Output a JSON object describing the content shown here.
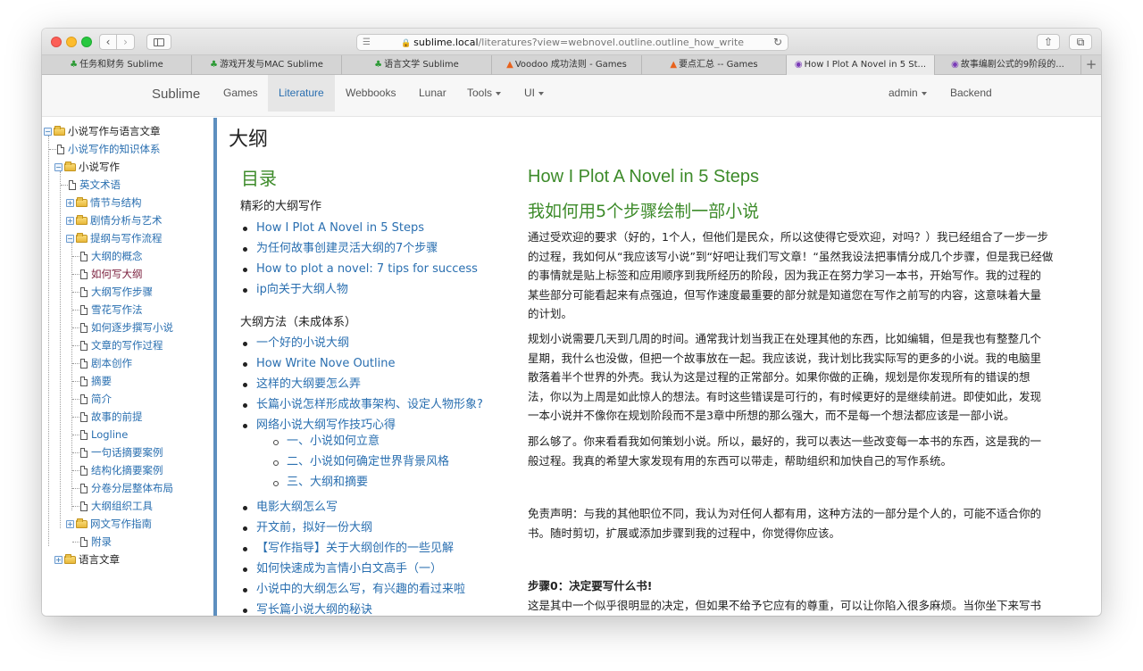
{
  "browser": {
    "url_host": "sublime.local",
    "url_path": "/literatures?view=webnovel.outline.outline_how_write",
    "tabs": [
      {
        "label": "任务和财务 Sublime",
        "icon": "clover-icon"
      },
      {
        "label": "游戏开发与MAC Sublime",
        "icon": "clover-icon"
      },
      {
        "label": "语言文学 Sublime",
        "icon": "clover-icon"
      },
      {
        "label": "Voodoo 成功法则 - Games",
        "icon": "fire-icon"
      },
      {
        "label": "要点汇总 -- Games",
        "icon": "fire-icon"
      },
      {
        "label": "How I Plot A Novel in 5 St...",
        "icon": "cat-icon"
      },
      {
        "label": "故事编剧公式的9阶段的...",
        "icon": "cat-icon"
      }
    ],
    "active_tab": 5
  },
  "navbar": {
    "brand": "Sublime",
    "items": [
      "Games",
      "Literature",
      "Webbooks",
      "Lunar",
      "Tools",
      "UI"
    ],
    "active": "Literature",
    "user": "admin",
    "backend": "Backend"
  },
  "tree": [
    {
      "label": "小说写作与语言文章",
      "type": "folder",
      "level": 0
    },
    {
      "label": "小说写作的知识体系",
      "type": "doc",
      "level": 1
    },
    {
      "label": "小说写作",
      "type": "folder",
      "level": 1
    },
    {
      "label": "英文术语",
      "type": "doc",
      "level": 2
    },
    {
      "label": "情节与结构",
      "type": "folder",
      "level": 2
    },
    {
      "label": "剧情分析与艺术",
      "type": "folder",
      "level": 2
    },
    {
      "label": "提纲与写作流程",
      "type": "folder",
      "level": 2
    },
    {
      "label": "大纲的概念",
      "type": "doc",
      "level": 3
    },
    {
      "label": "如何写大纲",
      "type": "doc",
      "level": 3,
      "selected": true
    },
    {
      "label": "大纲写作步骤",
      "type": "doc",
      "level": 3
    },
    {
      "label": "雪花写作法",
      "type": "doc",
      "level": 3
    },
    {
      "label": "如何逐步撰写小说",
      "type": "doc",
      "level": 3
    },
    {
      "label": "文章的写作过程",
      "type": "doc",
      "level": 3
    },
    {
      "label": "剧本创作",
      "type": "doc",
      "level": 3
    },
    {
      "label": "摘要",
      "type": "doc",
      "level": 3
    },
    {
      "label": "简介",
      "type": "doc",
      "level": 3
    },
    {
      "label": "故事的前提",
      "type": "doc",
      "level": 3
    },
    {
      "label": "Logline",
      "type": "doc",
      "level": 3
    },
    {
      "label": "一句话摘要案例",
      "type": "doc",
      "level": 3
    },
    {
      "label": "结构化摘要案例",
      "type": "doc",
      "level": 3
    },
    {
      "label": "分卷分层整体布局",
      "type": "doc",
      "level": 3
    },
    {
      "label": "大纲组织工具",
      "type": "doc",
      "level": 3
    },
    {
      "label": "网文写作指南",
      "type": "folder",
      "level": 2
    },
    {
      "label": "附录",
      "type": "doc",
      "level": 2
    },
    {
      "label": "语言文章",
      "type": "folder",
      "level": 1
    }
  ],
  "main": {
    "page_title": "大纲",
    "toc_title": "目录",
    "toc_sections": [
      {
        "title": "精彩的大纲写作",
        "items": [
          {
            "label": "How I Plot A Novel in 5 Steps"
          },
          {
            "label": "为任何故事创建灵活大纲的7个步骤"
          },
          {
            "label": "How to plot a novel: 7 tips for success"
          },
          {
            "label": "ip向关于大纲人物"
          }
        ]
      },
      {
        "title": "大纲方法（未成体系）",
        "items": [
          {
            "label": "一个好的小说大纲"
          },
          {
            "label": "How Write Nove Outline"
          },
          {
            "label": "这样的大纲要怎么弄"
          },
          {
            "label": "长篇小说怎样形成故事架构、设定人物形象?"
          },
          {
            "label": "网络小说大纲写作技巧心得"
          },
          {
            "label": "一、小说如何立意",
            "sub": true
          },
          {
            "label": "二、小说如何确定世界背景风格",
            "sub": true
          },
          {
            "label": "三、大纲和摘要",
            "sub": true
          },
          {
            "label": "电影大纲怎么写"
          },
          {
            "label": "开文前，拟好一份大纲"
          },
          {
            "label": "【写作指导】关于大纲创作的一些见解"
          },
          {
            "label": "如何快速成为言情小白文高手（一）"
          },
          {
            "label": "小说中的大纲怎么写，有兴趣的看过来啦"
          },
          {
            "label": "写长篇小说大纲的秘诀"
          }
        ]
      }
    ],
    "article": {
      "title_en": "How I Plot A Novel in 5 Steps",
      "title_cn": "我如何用5个步骤绘制一部小说",
      "paragraphs": [
        [
          "通过受欢迎的要求（好的，1个人，但他们是民众，所以这使得它受欢迎，对吗？）我已经组合了一步一步",
          "的过程，我如何从“我应该写小说”到“好吧让我们写文章！“虽然我设法把事情分成几个步骤，但是我已经做",
          "的事情就是贴上标签和应用顺序到我所经历的阶段，因为我正在努力学习一本书，开始写作。我的过程的",
          "某些部分可能看起来有点强迫，但写作速度最重要的部分就是知道您在写作之前写的内容，这意味着大量",
          "的计划。"
        ],
        [
          "规划小说需要几天到几周的时间。通常我计划当我正在处理其他的东西，比如编辑，但是我也有整整几个",
          "星期，我什么也没做，但把一个故事放在一起。我应该说，我计划比我实际写的更多的小说。我的电脑里",
          "散落着半个世界的外壳。我认为这是过程的正常部分。如果你做的正确，规划是你发现所有的错误的想",
          "法，你以为上周是如此惊人的想法。有时这些错误是可行的，有时候更好的是继续前进。即使如此，发现",
          "一本小说并不像你在规划阶段而不是3章中所想的那么强大，而不是每一个想法都应该是一部小说。"
        ],
        [
          "那么够了。你来看看我如何策划小说。所以，最好的，我可以表达一些改变每一本书的东西，这是我的一",
          "般过程。我真的希望大家发现有用的东西可以带走，帮助组织和加快自己的写作系统。"
        ],
        [
          "免责声明：与我的其他职位不同，我认为对任何人都有用，这种方法的一部分是个人的，可能不适合你的",
          "书。随时剪切，扩展或添加步骤到我的过程中，你觉得你应该。"
        ],
        [
          "步骤0：决定要写什么书!"
        ],
        [
          "这是其中一个似乎很明显的决定，但如果不给予它应有的尊重，可以让你陷入很多麻烦。当你坐下来写书"
        ]
      ]
    }
  }
}
